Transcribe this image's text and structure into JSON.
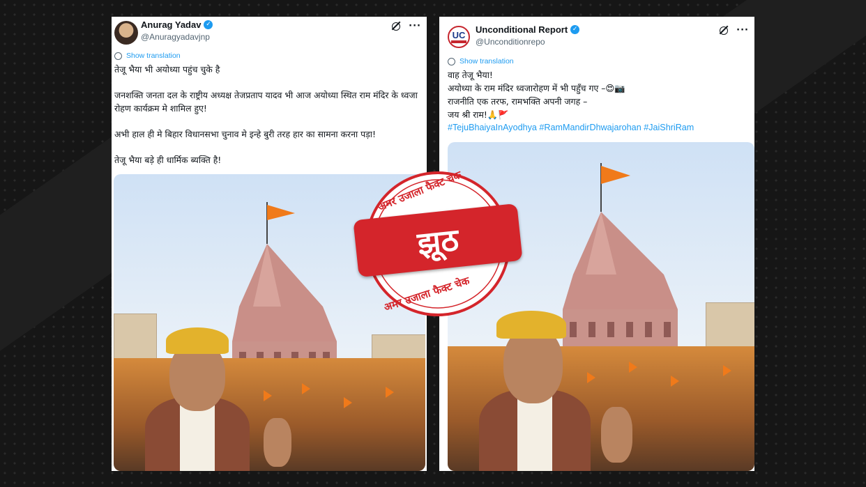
{
  "left_post": {
    "name": "Anurag Yadav",
    "handle": "@Anuragyadavjnp",
    "show_translation": "Show translation",
    "lines": [
      "तेजू भैया भी अयोध्या पहुंच चुके है",
      "जनशक्ति जनता दल के राष्ट्रीय अध्यक्ष तेजप्रताप यादव भी आज अयोध्या स्थित राम मंदिर के ध्वजा रोहण कार्यक्रम मे शामिल हुए!",
      "अभी हाल ही मे बिहार विधानसभा चुनाव मे इन्हे बुरी तरह हार का सामना करना पड़ा!",
      "तेजू भैया बड़े ही धार्मिक ब्यक्ति है!"
    ]
  },
  "right_post": {
    "avatar_text": "UC",
    "name": "Unconditional Report",
    "handle": "@Unconditionrepo",
    "show_translation": "Show translation",
    "lines": [
      "वाह तेजू भैया!",
      "अयोध्या के राम मंदिर ध्वजारोहण में भी पहुँच गए –😍📷",
      "राजनीति एक तरफ, रामभक्ति अपनी जगह –",
      "जय श्री राम!🙏🚩"
    ],
    "hashtags": "#TejuBhaiyaInAyodhya #RamMandirDhwajarohan #JaiShriRam"
  },
  "stamp": {
    "top_text": "अमर उजाला फैक्ट चेक",
    "verdict": "झूठ",
    "bottom_text": "अमर उजाला फैक्ट चेक",
    "color": "#d4252b"
  },
  "icons": {
    "verified": "✓",
    "more": "···"
  }
}
